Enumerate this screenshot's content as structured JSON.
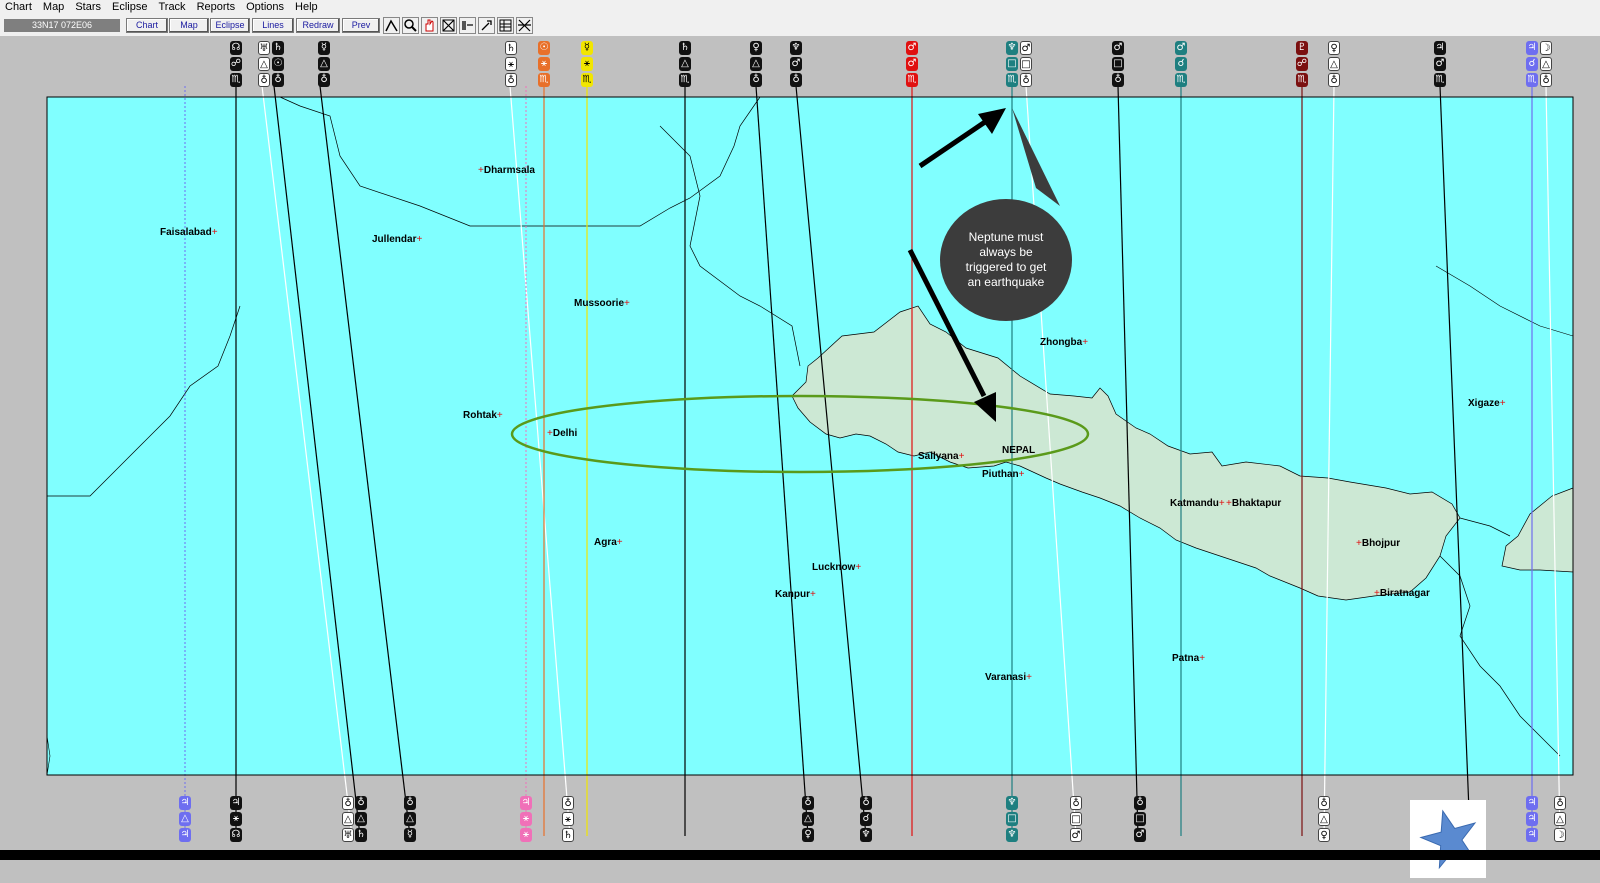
{
  "menu": {
    "items": [
      "Chart",
      "Map",
      "Stars",
      "Eclipse",
      "Track",
      "Reports",
      "Options",
      "Help"
    ]
  },
  "toolbar": {
    "coord": "33N17 072E06",
    "buttons": [
      "Chart",
      "Map",
      "Eclipse",
      "Lines",
      "Redraw",
      "Prev"
    ],
    "icons": [
      "line-tool-icon",
      "zoom-icon",
      "hand-icon",
      "crossing-icon",
      "scale-icon",
      "add-icon",
      "grid-icon",
      "cross-lines-icon"
    ]
  },
  "map": {
    "cities": [
      "Dharmsala",
      "Faisalabad",
      "Jullendar",
      "Mussoorie",
      "Rohtak",
      "Delhi",
      "Agra",
      "Sallyana",
      "NEPAL",
      "Piuthan",
      "Zhongba",
      "Katmandu",
      "Bhaktapur",
      "Lucknow",
      "Kanpur",
      "Bhojpur",
      "Biratnagar",
      "Patna",
      "Varanasi",
      "Xigaze"
    ],
    "colors": {
      "sea": "#80ffff",
      "land": "#cce8d4",
      "frame": "#c0c0c0",
      "ellipse": "#5a9a1a"
    }
  },
  "annotation": {
    "text": "Neptune must always be triggered to get an earthquake",
    "color": "#3c3c3c"
  },
  "lines": {
    "top_labels": [
      "☊☍♏",
      "♅♄♁",
      "☿△♏",
      "♄⚹♁",
      "☉⚹♏",
      "☿⚹♏",
      "♄△♏",
      "♀△♏",
      "♆☌♏",
      "♂♂♏",
      "♆□♏",
      "♂□♏",
      "♂☌♏",
      "♇☍♏",
      "♀△♁",
      "♃☌♏",
      "♃☌♏",
      "☽△♁"
    ],
    "bottom_labels": [
      "♃△♃",
      "♃⚹☊",
      "♁♃♅",
      "♁△☿",
      "♃⚹⚹",
      "♁♄♄",
      "♁△♀",
      "♁☌♆",
      "♆□♆",
      "♁□♂",
      "♁□♂",
      "♁△♀",
      "♃♃♃",
      "♁△☽"
    ]
  }
}
